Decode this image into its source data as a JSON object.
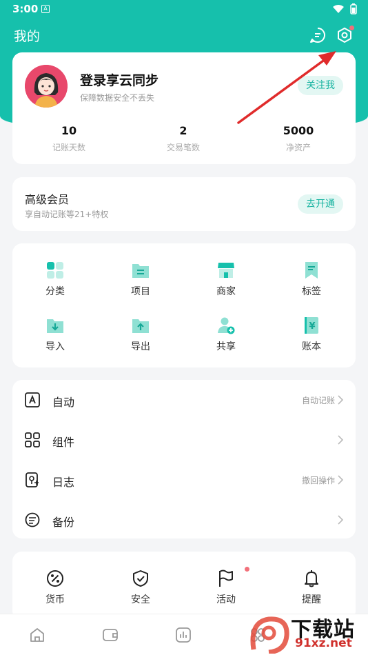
{
  "status": {
    "time": "3:00"
  },
  "header": {
    "title": "我的"
  },
  "profile": {
    "name": "登录享云同步",
    "subtitle": "保障数据安全不丢失",
    "follow_label": "关注我",
    "stats": [
      {
        "value": "10",
        "label": "记账天数"
      },
      {
        "value": "2",
        "label": "交易笔数"
      },
      {
        "value": "5000",
        "label": "净资产"
      }
    ]
  },
  "vip": {
    "title": "高级会员",
    "subtitle": "享自动记账等21+特权",
    "button": "去开通"
  },
  "tools": [
    {
      "label": "分类",
      "icon": "category-icon"
    },
    {
      "label": "项目",
      "icon": "project-folder-icon"
    },
    {
      "label": "商家",
      "icon": "store-icon"
    },
    {
      "label": "标签",
      "icon": "tag-icon"
    },
    {
      "label": "导入",
      "icon": "import-icon"
    },
    {
      "label": "导出",
      "icon": "export-icon"
    },
    {
      "label": "共享",
      "icon": "share-user-icon"
    },
    {
      "label": "账本",
      "icon": "ledger-book-icon"
    }
  ],
  "list": [
    {
      "label": "自动",
      "hint": "自动记账",
      "icon": "auto-a-icon"
    },
    {
      "label": "组件",
      "hint": "",
      "icon": "widget-grid-icon"
    },
    {
      "label": "日志",
      "hint": "撤回操作",
      "icon": "log-icon"
    },
    {
      "label": "备份",
      "hint": "",
      "icon": "backup-icon"
    }
  ],
  "more": [
    {
      "label": "货币",
      "icon": "currency-percent-icon"
    },
    {
      "label": "安全",
      "icon": "security-shield-icon"
    },
    {
      "label": "活动",
      "icon": "activity-flag-icon"
    },
    {
      "label": "提醒",
      "icon": "reminder-bell-icon"
    }
  ],
  "watermark": {
    "big": "下载站",
    "small": "91xz.net"
  },
  "colors": {
    "accent": "#16c0ac",
    "accent_light": "#e3f7f3",
    "badge": "#f2707a",
    "arrow": "#e02b2b"
  }
}
